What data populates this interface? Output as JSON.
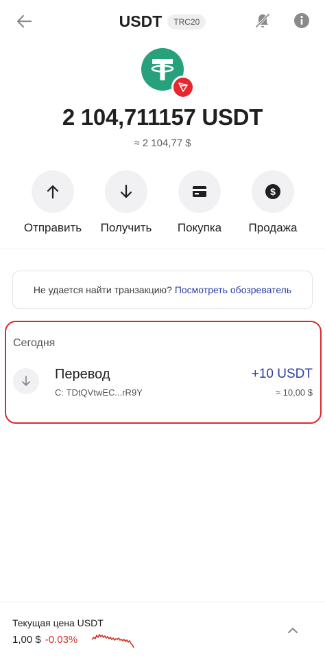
{
  "header": {
    "title": "USDT",
    "network": "TRC20",
    "back_icon": "arrow-left-icon",
    "bell_icon": "bell-off-icon",
    "info_icon": "info-icon"
  },
  "token": {
    "logo_icon": "tether-logo-icon",
    "network_icon": "tron-logo-icon",
    "brand_color": "#26a17b",
    "network_color": "#e5282e"
  },
  "balance": {
    "amount": "2 104,711157 USDT",
    "fiat": "≈ 2 104,77 $"
  },
  "actions": [
    {
      "label": "Отправить",
      "icon": "arrow-up-icon"
    },
    {
      "label": "Получить",
      "icon": "arrow-down-icon"
    },
    {
      "label": "Покупка",
      "icon": "card-icon"
    },
    {
      "label": "Продажа",
      "icon": "dollar-circle-icon"
    }
  ],
  "notice": {
    "text": "Не удается найти транзакцию?",
    "link": "Посмотреть обозреватель",
    "link_color": "#2b3ea8"
  },
  "transactions": {
    "section_title": "Сегодня",
    "highlight_color": "#e0262e",
    "items": [
      {
        "title": "Перевод",
        "from": "С: TDtQVtwEC...rR9Y",
        "amount": "+10 USDT",
        "fiat": "≈ 10,00 $",
        "icon": "arrow-down-icon"
      }
    ]
  },
  "price_bar": {
    "label": "Текущая цена USDT",
    "price": "1,00 $",
    "change": "-0.03%",
    "change_color": "#d93025",
    "chevron_icon": "chevron-up-icon"
  }
}
